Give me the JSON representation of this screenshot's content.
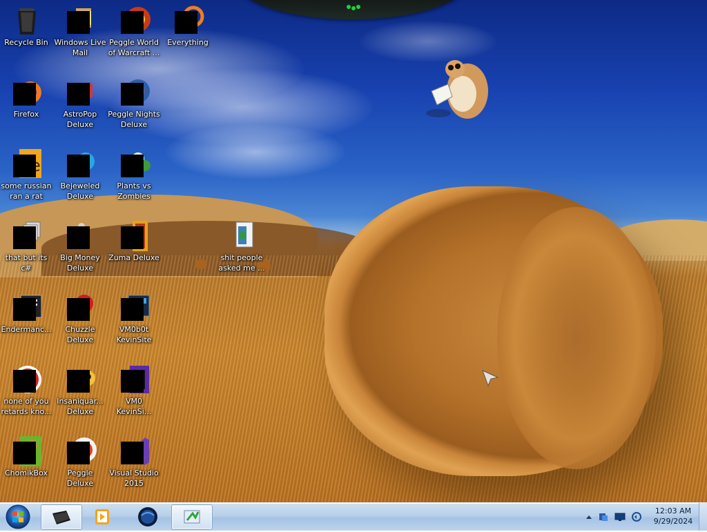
{
  "desktop": {
    "icons": [
      {
        "label": "Recycle Bin",
        "icon": "recycle-bin-icon"
      },
      {
        "label": "Windows Live Mail",
        "icon": "mail-icon"
      },
      {
        "label": "Peggle World of Warcraft ...",
        "icon": "game-icon"
      },
      {
        "label": "Everything",
        "icon": "search-icon"
      },
      {
        "label": "Firefox",
        "icon": "firefox-icon"
      },
      {
        "label": "AstroPop Deluxe",
        "icon": "game-icon"
      },
      {
        "label": "Peggle Nights Deluxe",
        "icon": "game-icon"
      },
      {
        "label": "some russian ran a rat",
        "icon": "app-icon"
      },
      {
        "label": "Bejeweled Deluxe",
        "icon": "game-icon"
      },
      {
        "label": "Plants vs Zombies",
        "icon": "game-icon"
      },
      {
        "label": "that but its c#",
        "icon": "app-icon"
      },
      {
        "label": "Big Money Deluxe",
        "icon": "game-icon"
      },
      {
        "label": "Zuma Deluxe",
        "icon": "game-icon"
      },
      {
        "label": "shit people asked me ...",
        "icon": "folder-icon"
      },
      {
        "label": "Endermanc...",
        "icon": "app-icon"
      },
      {
        "label": "Chuzzle Deluxe",
        "icon": "game-icon"
      },
      {
        "label": "VM0b0t KevinSite",
        "icon": "app-icon"
      },
      {
        "label": "none of you retards kno...",
        "icon": "app-icon"
      },
      {
        "label": "Insaniquar... Deluxe",
        "icon": "game-icon"
      },
      {
        "label": "VM0 KevinSi...",
        "icon": "app-icon"
      },
      {
        "label": "ChomikBox",
        "icon": "app-icon"
      },
      {
        "label": "Peggle Deluxe",
        "icon": "game-icon"
      },
      {
        "label": "Visual Studio 2015",
        "icon": "visual-studio-icon"
      }
    ]
  },
  "taskbar": {
    "start_label": "Start",
    "pinned": [
      {
        "name": "file-explorer",
        "icon": "folder-icon"
      },
      {
        "name": "media-player",
        "icon": "media-player-icon"
      },
      {
        "name": "browser",
        "icon": "globe-icon"
      },
      {
        "name": "active-app",
        "icon": "app-icon"
      }
    ],
    "clock": {
      "time": "12:03 AM",
      "date": "9/29/2024"
    }
  }
}
